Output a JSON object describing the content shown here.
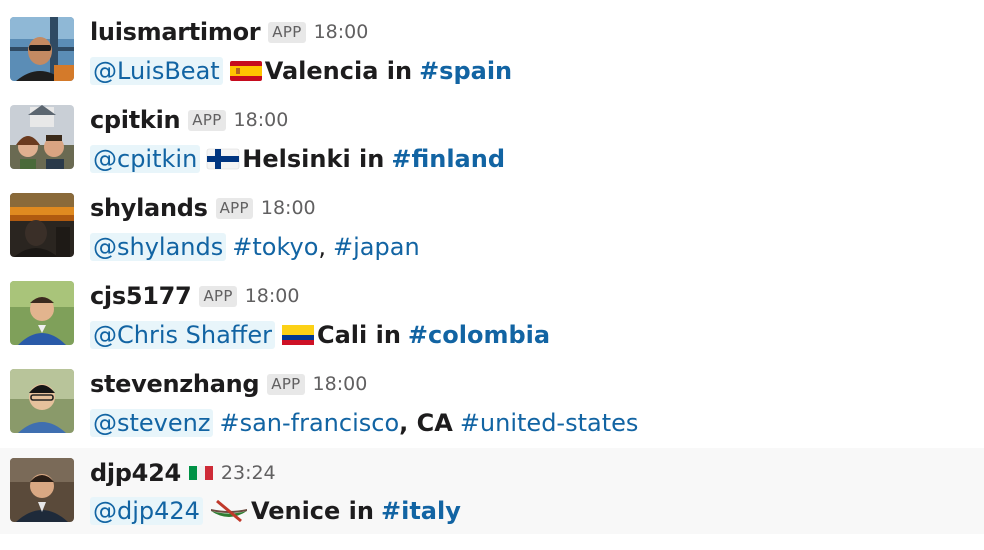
{
  "messages": [
    {
      "username": "luismartimor",
      "badge": "APP",
      "time": "18:00",
      "mention": "@LuisBeat",
      "flag_icon": "spain-flag-icon",
      "text": "Valencia in",
      "channel": "#spain"
    },
    {
      "username": "cpitkin",
      "badge": "APP",
      "time": "18:00",
      "mention": "@cpitkin",
      "flag_icon": "finland-flag-icon",
      "text": "Helsinki in",
      "channel": "#finland"
    },
    {
      "username": "shylands",
      "badge": "APP",
      "time": "18:00",
      "mention": "@shylands",
      "channel1": "#tokyo",
      "sep": ",",
      "channel2": "#japan"
    },
    {
      "username": "cjs5177",
      "badge": "APP",
      "time": "18:00",
      "mention": "@Chris Shaffer",
      "flag_icon": "colombia-flag-icon",
      "text": "Cali in",
      "channel": "#colombia"
    },
    {
      "username": "stevenzhang",
      "badge": "APP",
      "time": "18:00",
      "mention": "@stevenz",
      "channel1": "#san-francisco",
      "mid": ", CA",
      "channel2": "#united-states"
    },
    {
      "username": "djp424",
      "status_icon": "italy-flag-icon",
      "time": "23:24",
      "mention": "@djp424",
      "boat_icon": "canoe-icon",
      "text": "Venice in",
      "channel": "#italy"
    }
  ],
  "colors": {
    "link": "#1264a3",
    "mention_bg": "#e8f5fa",
    "hover_row_bg": "#f8f8f8",
    "timestamp": "#616061"
  }
}
